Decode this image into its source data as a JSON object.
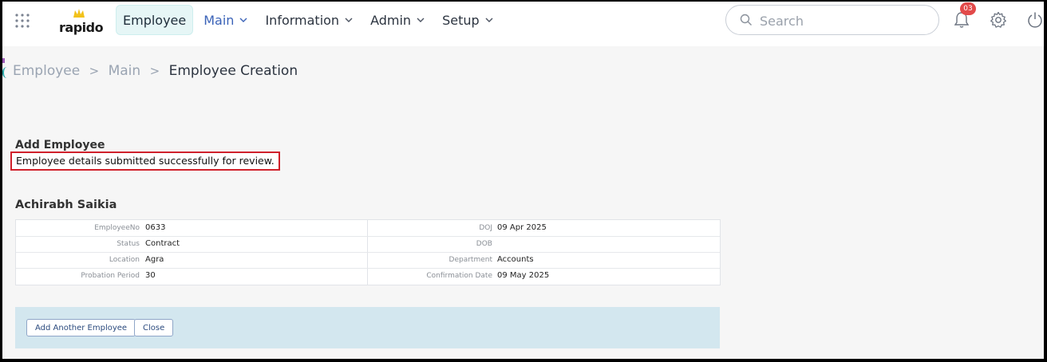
{
  "header": {
    "logo_text": "rapido",
    "nav": [
      {
        "label": "Employee"
      },
      {
        "label": "Main"
      },
      {
        "label": "Information"
      },
      {
        "label": "Admin"
      },
      {
        "label": "Setup"
      }
    ],
    "search_placeholder": "Search",
    "notifications_count": "03",
    "icons": [
      "apps-grid-icon",
      "bell-icon",
      "gear-icon",
      "power-icon"
    ]
  },
  "breadcrumb": {
    "items": [
      "Employee",
      "Main"
    ],
    "current": "Employee Creation",
    "separator": ">"
  },
  "page": {
    "section_title": "Add Employee",
    "success_message": "Employee details submitted successfully for review.",
    "employee_name": "Achirabh Saikia"
  },
  "details": {
    "rows": [
      {
        "left_label": "EmployeeNo",
        "left_value": "0633",
        "right_label": "DOJ",
        "right_value": "09 Apr 2025"
      },
      {
        "left_label": "Status",
        "left_value": "Contract",
        "right_label": "DOB",
        "right_value": ""
      },
      {
        "left_label": "Location",
        "left_value": "Agra",
        "right_label": "Department",
        "right_value": "Accounts"
      },
      {
        "left_label": "Probation Period",
        "left_value": "30",
        "right_label": "Confirmation Date",
        "right_value": "09 May 2025"
      }
    ]
  },
  "actions": {
    "add_another_label": "Add Another Employee",
    "close_label": "Close"
  },
  "colors": {
    "active_nav_bg": "#e6f6f6",
    "current_nav": "#3b63b8",
    "badge": "#e24a4a",
    "message_border": "#d0212b",
    "action_bar": "#d3e7ef"
  }
}
